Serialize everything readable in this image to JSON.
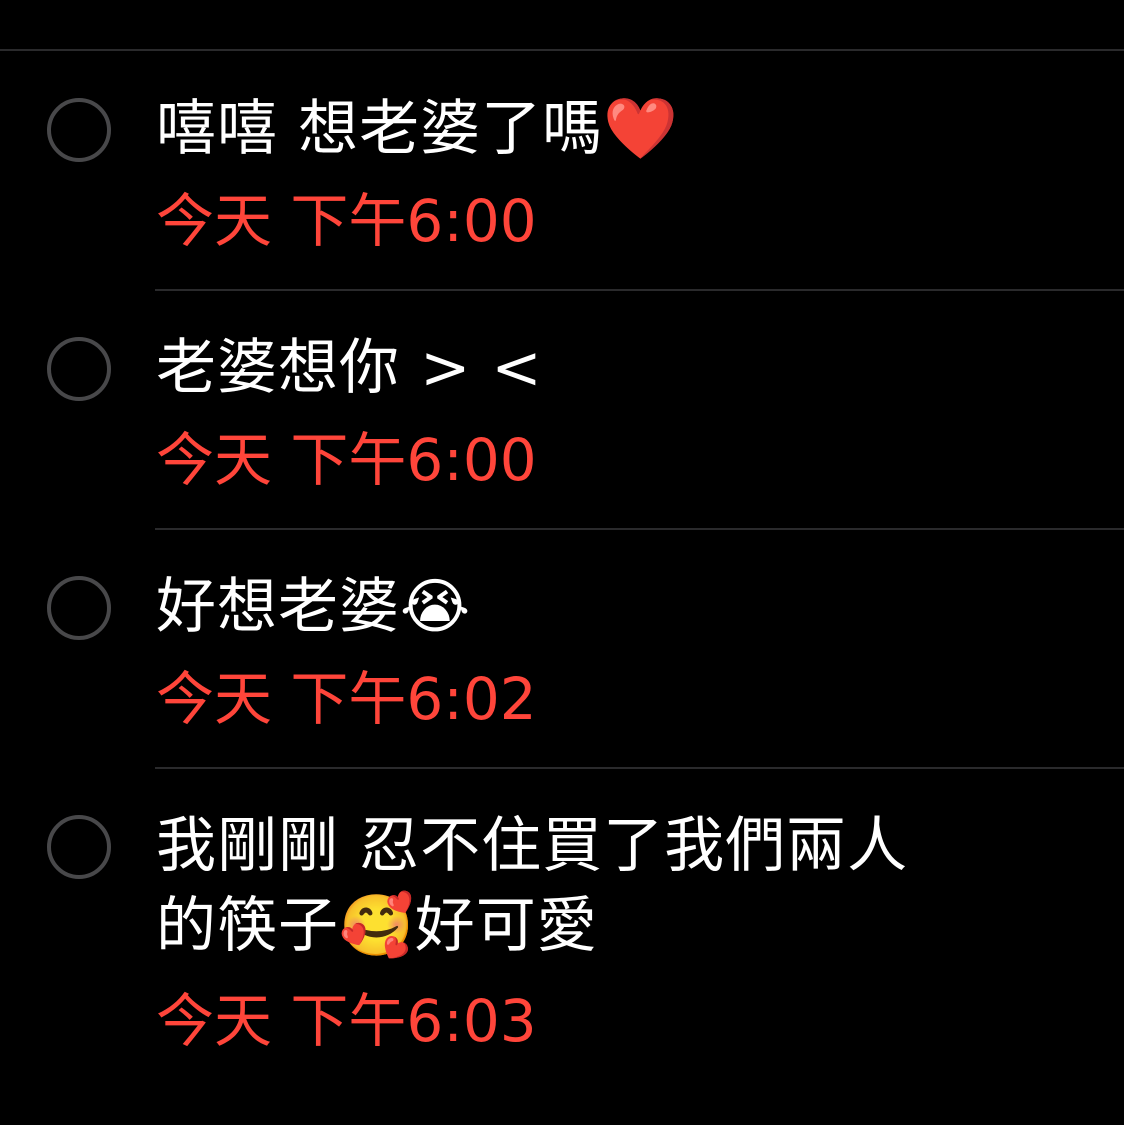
{
  "reminders": [
    {
      "title": "嘻嘻 想老婆了嗎❤️",
      "time": "今天 下午6:00"
    },
    {
      "title": "老婆想你 > <",
      "time": "今天 下午6:00"
    },
    {
      "title": "好想老婆😭",
      "time": "今天 下午6:02"
    },
    {
      "title": "我剛剛 忍不住買了我們兩人\n的筷子🥰好可愛",
      "time": "今天 下午6:03"
    }
  ],
  "colors": {
    "background": "#000000",
    "title_text": "#ffffff",
    "time_text": "#ff453a",
    "circle_border": "#48484a",
    "divider": "#2a2a2c"
  }
}
